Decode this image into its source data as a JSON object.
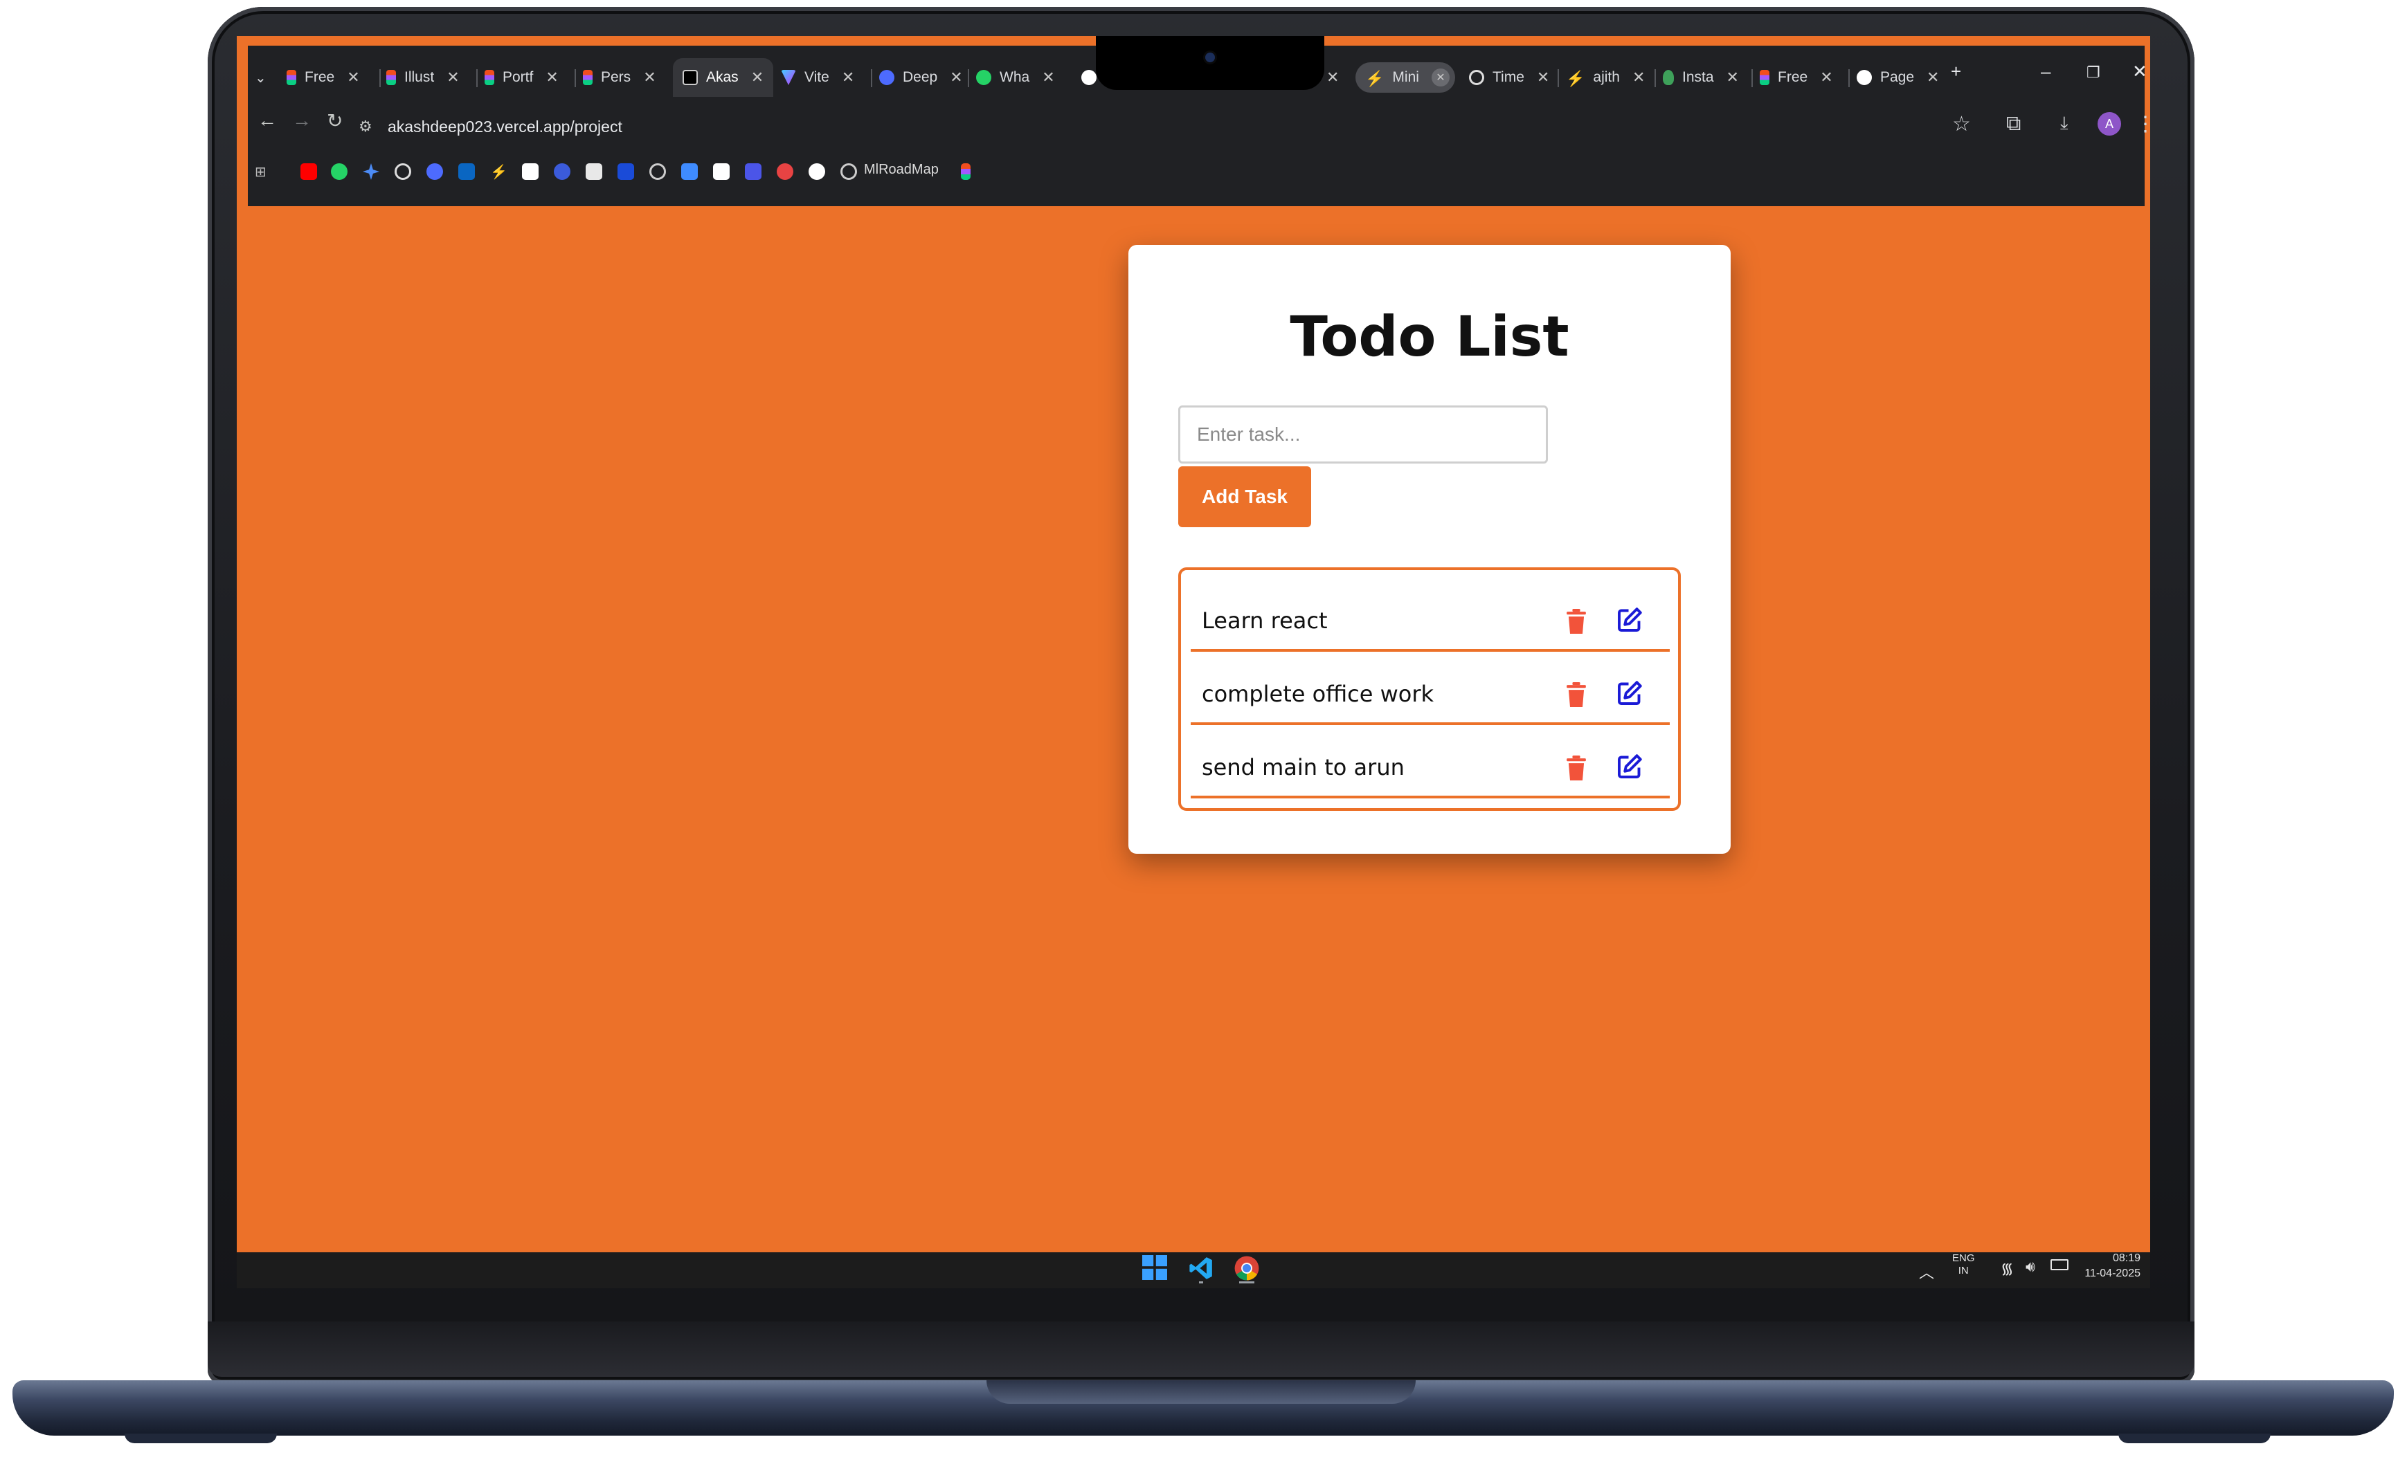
{
  "browser": {
    "tabs": [
      {
        "label": "Free",
        "favicon": "figma-icon"
      },
      {
        "label": "Illust",
        "favicon": "figma-icon"
      },
      {
        "label": "Portf",
        "favicon": "figma-icon"
      },
      {
        "label": "Pers",
        "favicon": "figma-icon"
      },
      {
        "label": "Akas",
        "favicon": "vercel-icon",
        "active": true
      },
      {
        "label": "Vite",
        "favicon": "vite-icon"
      },
      {
        "label": "Deep",
        "favicon": "deepseek-icon"
      },
      {
        "label": "Wha",
        "favicon": "whatsapp-icon"
      },
      {
        "label": "Mini",
        "favicon": "bolt-icon"
      },
      {
        "label": "Time",
        "favicon": "clock-icon"
      },
      {
        "label": "ajith",
        "favicon": "bolt-icon"
      },
      {
        "label": "Insta",
        "favicon": "instagram-icon"
      },
      {
        "label": "Free",
        "favicon": "figma-icon"
      },
      {
        "label": "Page",
        "favicon": "github-icon"
      }
    ],
    "url": "akashdeep023.vercel.app/project",
    "avatar_letter": "A",
    "bookmark_label": "MlRoadMap"
  },
  "todo": {
    "title": "Todo List",
    "input_placeholder": "Enter task...",
    "input_value": "",
    "add_button_label": "Add Task",
    "tasks": [
      {
        "text": "Learn react"
      },
      {
        "text": "complete office work"
      },
      {
        "text": "send main to arun"
      }
    ]
  },
  "taskbar": {
    "lang_line1": "ENG",
    "lang_line2": "IN",
    "time": "08:19",
    "date": "11-04-2025"
  },
  "colors": {
    "accent": "#ec7129",
    "delete": "#f2533a",
    "edit": "#1a1ad6"
  }
}
